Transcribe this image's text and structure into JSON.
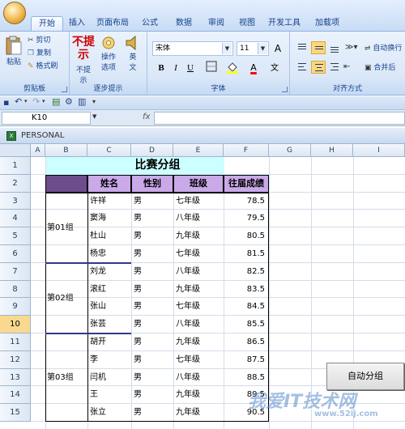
{
  "ribbon": {
    "tabs": [
      "开始",
      "插入",
      "页面布局",
      "公式",
      "数据",
      "审阅",
      "视图",
      "开发工具",
      "加载项"
    ],
    "clipboard": {
      "paste": "粘贴",
      "cut": "剪切",
      "copy": "复制",
      "format_painter": "格式刷",
      "label": "剪贴板"
    },
    "step_hint": {
      "no_hint": "不提示",
      "no_hint_top": "不提",
      "no_hint_bottom": "示",
      "options_top": "操作",
      "options_bottom": "选项",
      "english_top": "英",
      "english_bottom": "文",
      "label": "逐步提示"
    },
    "font": {
      "font_name": "宋体",
      "font_size": "11",
      "label": "字体",
      "bold": "B",
      "italic": "I",
      "underline": "U",
      "grow": "A",
      "shrink": "A",
      "wen": "文"
    },
    "alignment": {
      "wrap": "自动换行",
      "merge": "合并后",
      "label": "对齐方式"
    },
    "colors": {
      "accent": "#fbd681",
      "font_color": "#ff0000",
      "fill_color": "#ffff00"
    }
  },
  "formula_bar": {
    "cell_ref": "K10",
    "fx": "fx",
    "formula": ""
  },
  "workbook": {
    "title": "PERSONAL",
    "xl_icon": "X",
    "columns": [
      "A",
      "B",
      "C",
      "D",
      "E",
      "F",
      "G",
      "H",
      "I"
    ],
    "rows": [
      "1",
      "2",
      "3",
      "4",
      "5",
      "6",
      "7",
      "8",
      "9",
      "10",
      "11",
      "12",
      "13",
      "14",
      "15"
    ],
    "selected_row": "10",
    "sheet_title": "比赛分组",
    "headers": {
      "name": "姓名",
      "gender": "性别",
      "class": "班级",
      "score": "往届成绩"
    },
    "groups": [
      "第01组",
      "第02组",
      "第03组"
    ],
    "records": [
      {
        "name": "许祥",
        "gender": "男",
        "class": "七年级",
        "score": "78.5"
      },
      {
        "name": "窦海",
        "gender": "男",
        "class": "八年级",
        "score": "79.5"
      },
      {
        "name": "杜山",
        "gender": "男",
        "class": "九年级",
        "score": "80.5"
      },
      {
        "name": "杨忠",
        "gender": "男",
        "class": "七年级",
        "score": "81.5"
      },
      {
        "name": "刘龙",
        "gender": "男",
        "class": "八年级",
        "score": "82.5"
      },
      {
        "name": "滚红",
        "gender": "男",
        "class": "九年级",
        "score": "83.5"
      },
      {
        "name": "张山",
        "gender": "男",
        "class": "七年级",
        "score": "84.5"
      },
      {
        "name": "张芸",
        "gender": "男",
        "class": "八年级",
        "score": "85.5"
      },
      {
        "name": "胡开",
        "gender": "男",
        "class": "九年级",
        "score": "86.5"
      },
      {
        "name": "李",
        "gender": "男",
        "class": "七年级",
        "score": "87.5"
      },
      {
        "name": "闫机",
        "gender": "男",
        "class": "八年级",
        "score": "88.5"
      },
      {
        "name": "王",
        "gender": "男",
        "class": "九年级",
        "score": "89.5"
      },
      {
        "name": "张立",
        "gender": "男",
        "class": "九年级",
        "score": "90.5"
      }
    ],
    "auto_group_button": "自动分组"
  },
  "watermark": {
    "main": "我爱IT技术网",
    "sub": "www.52ij.com"
  }
}
